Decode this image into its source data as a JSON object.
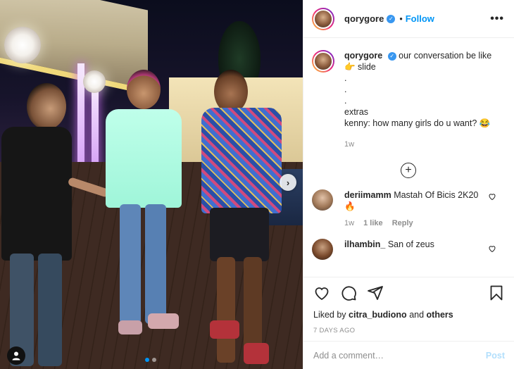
{
  "post": {
    "username": "qorygore",
    "follow_label": "Follow",
    "separator": "•",
    "more_label": "•••"
  },
  "caption": {
    "username": "qorygore",
    "lines": [
      "our conversation be like",
      "👉 slide",
      ".",
      ".",
      ".",
      "extras",
      "kenny: how many girls do u want? 😂"
    ],
    "time": "1w"
  },
  "comments": [
    {
      "username": "deriimamm",
      "text": "Mastah Of Bicis 2K20",
      "emoji": "🔥",
      "time": "1w",
      "likes": "1 like",
      "reply": "Reply"
    },
    {
      "username": "ilhambin_",
      "text": "San of zeus"
    }
  ],
  "actions": {
    "liked_prefix": "Liked by",
    "liked_user": "citra_budiono",
    "liked_and": "and",
    "liked_others": "others",
    "date": "7 DAYS AGO"
  },
  "add_comment": {
    "placeholder": "Add a comment…",
    "post_label": "Post"
  },
  "carousel": {
    "next_glyph": "›",
    "slides": 2,
    "current": 1
  },
  "colors": {
    "accent": "#0095f6",
    "muted": "#8e8e8e",
    "verified": "#3897f0"
  },
  "icons": [
    "heart-icon",
    "comment-icon",
    "share-icon",
    "bookmark-icon",
    "plus-circle-icon",
    "verified-badge-icon",
    "user-tag-icon",
    "chevron-right-icon"
  ]
}
